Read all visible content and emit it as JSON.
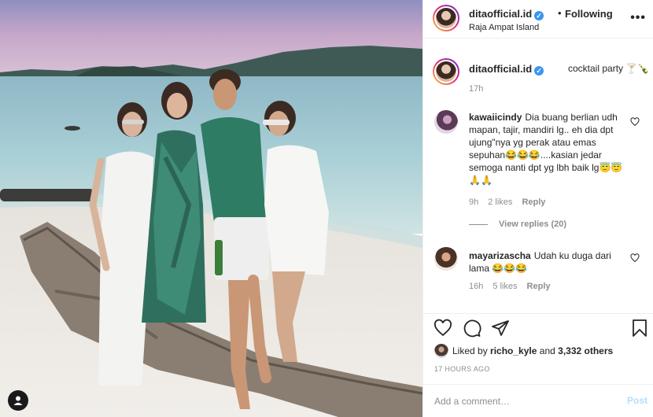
{
  "post": {
    "username": "ditaofficial.id",
    "follow_status": "Following",
    "separator": "•",
    "location": "Raja Ampat Island",
    "more_icon": "more-dots-icon",
    "caption": {
      "username": "ditaofficial.id",
      "text": "cocktail party 🍸🍾",
      "time": "17h"
    }
  },
  "comments": [
    {
      "username": "kawaiicindy",
      "text": "Dia buang berlian udh mapan, tajir, mandiri lg.. eh dia dpt ujung\"nya yg perak atau emas sepuhan😂😂😂....kasian jedar semoga nanti dpt yg lbh baik lg😇😇🙏🙏",
      "time": "9h",
      "likes": "2 likes",
      "reply": "Reply",
      "view_replies": "View replies (20)"
    },
    {
      "username": "mayarizascha",
      "text": "Udah ku duga dari lama 😂😂😂",
      "time": "16h",
      "likes": "5 likes",
      "reply": "Reply"
    }
  ],
  "liked_by": {
    "prefix": "Liked by",
    "user": "richo_kyle",
    "and": "and",
    "others": "3,332 others"
  },
  "posted_ago": "17 HOURS AGO",
  "add_comment": {
    "placeholder": "Add a comment…",
    "post_label": "Post"
  },
  "colors": {
    "link_blue": "#3897f0",
    "post_disabled": "#b2dffc",
    "muted_text": "#8e8e8e",
    "border": "#efefef"
  }
}
